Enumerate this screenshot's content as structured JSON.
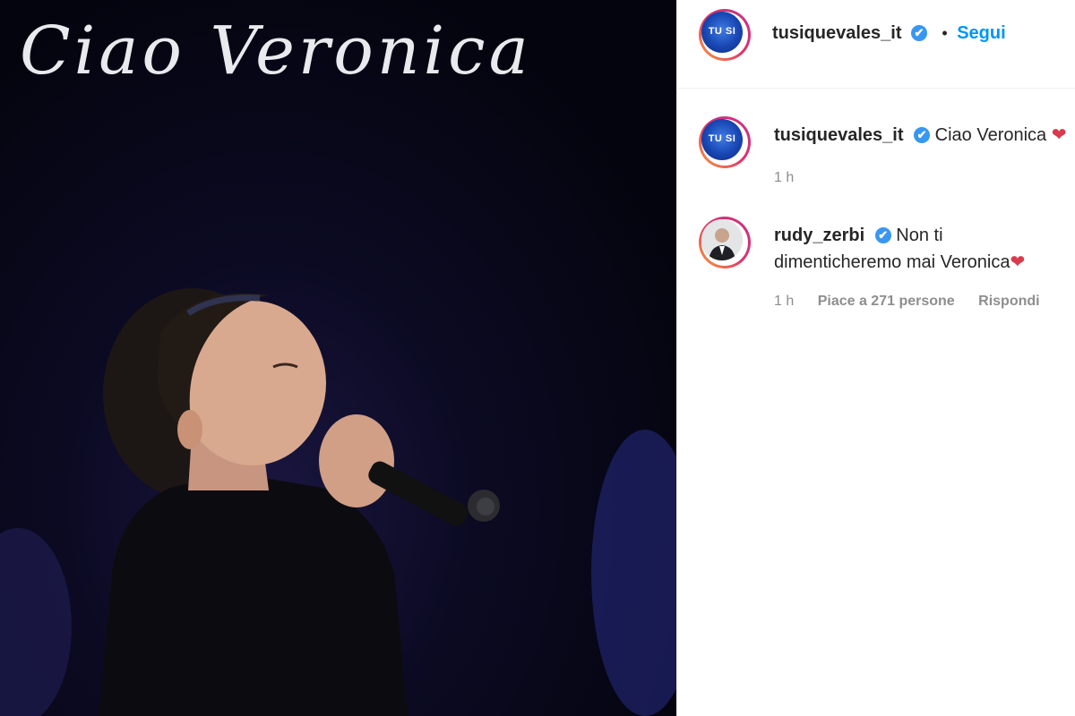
{
  "media": {
    "overlay_title": "Ciao Veronica"
  },
  "header": {
    "username": "tusiquevales_it",
    "verified_mark": "✔",
    "separator": "•",
    "follow_label": "Segui",
    "logo_text": "TU SI"
  },
  "comments": [
    {
      "username": "tusiquevales_it",
      "verified_mark": "✔",
      "text": "Ciao Veronica",
      "emoji": "❤",
      "time": "1 h"
    },
    {
      "username": "rudy_zerbi",
      "verified_mark": "✔",
      "text": "Non ti dimenticheremo mai Veronica",
      "emoji": "❤",
      "time": "1 h",
      "likes": "Piace a 271 persone",
      "reply_label": "Rispondi"
    }
  ],
  "colors": {
    "link": "#0095f6",
    "verified": "#3897f0",
    "heart": "#d93a4c"
  }
}
